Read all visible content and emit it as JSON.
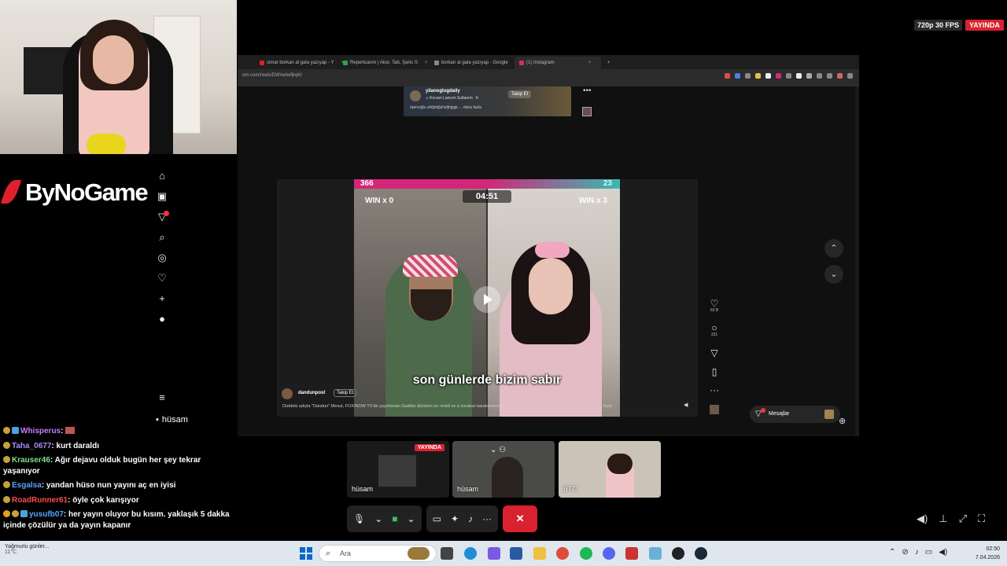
{
  "stream_status": {
    "quality": "720p 30 FPS",
    "live": "YAYINDA"
  },
  "logo": "ByNoGame",
  "browser": {
    "tabs": [
      {
        "label": "simar borkan al gala yazıyap - Y",
        "color": "#e02020"
      },
      {
        "label": "Repertuarım | Akor, Tab, Şarkı S",
        "color": "#2ea44f"
      },
      {
        "label": "borkan al gala yazıyap - Google",
        "color": "#888888"
      },
      {
        "label": "(1) Instagram",
        "color": "#d62976"
      }
    ],
    "url": "om.com/reels/DWnwlwfjkqK/"
  },
  "story": {
    "username": "yilanoglugdaily",
    "subtitle": "♫ Kocam Lancım Sultanım · K",
    "follow": "Takip Et",
    "description": "öpenoğlu shfjshjfjshsfjhjpgk ... daha fazla"
  },
  "video": {
    "score_left": "366",
    "score_right": "23",
    "timer": "04:51",
    "win_left": "WIN x 0",
    "win_right": "WIN x 3",
    "caption": "son günlerde bizim sabır"
  },
  "post": {
    "username": "dandunpost",
    "follow": "Takip Et",
    "description": "Dizideki adıyla \"Dandun\" Mesut, FOX/NOW TV'de yayınlanan Gaddar dizisinin en renkli ve iz bırakan karakterlerinden biriydi. Oyuncu kimutcan ufbebay tarafın ... daha fazla"
  },
  "actions": {
    "likes": "60 B",
    "comments": "331"
  },
  "messages_label": "Mesajlar",
  "ig_user_tag": "hüsam",
  "call_tiles": [
    {
      "label": "hüsam",
      "live": "YAYINDA"
    },
    {
      "label": "hüsam"
    },
    {
      "label": "BTC"
    }
  ],
  "chat": [
    {
      "user": "Whisperus",
      "color": "#c77dff",
      "text": ""
    },
    {
      "user": "Taha_0677",
      "color": "#a78bfa",
      "text": "kurt daraldı"
    },
    {
      "user": "Krauser46",
      "color": "#7ee787",
      "text": "Ağır dejavu olduk bugün her şey tekrar yaşanıyor"
    },
    {
      "user": "Esgalsa",
      "color": "#58a6ff",
      "text": "yandan hüso nun yayını aç en iyisi"
    },
    {
      "user": "RoadRunner61",
      "color": "#ff4d4d",
      "text": "öyle çok karışıyor"
    },
    {
      "user": "yusufb07",
      "color": "#58a6ff",
      "text": "her yayın oluyor bu kısım. yaklaşık 5 dakka içinde çözülür ya da yayın kapanır"
    }
  ],
  "taskbar": {
    "weather_title": "Yağmurlu günler...",
    "weather_temp": "11°C",
    "search_placeholder": "Ara",
    "time": "02:50",
    "date": "7.04.2026"
  }
}
